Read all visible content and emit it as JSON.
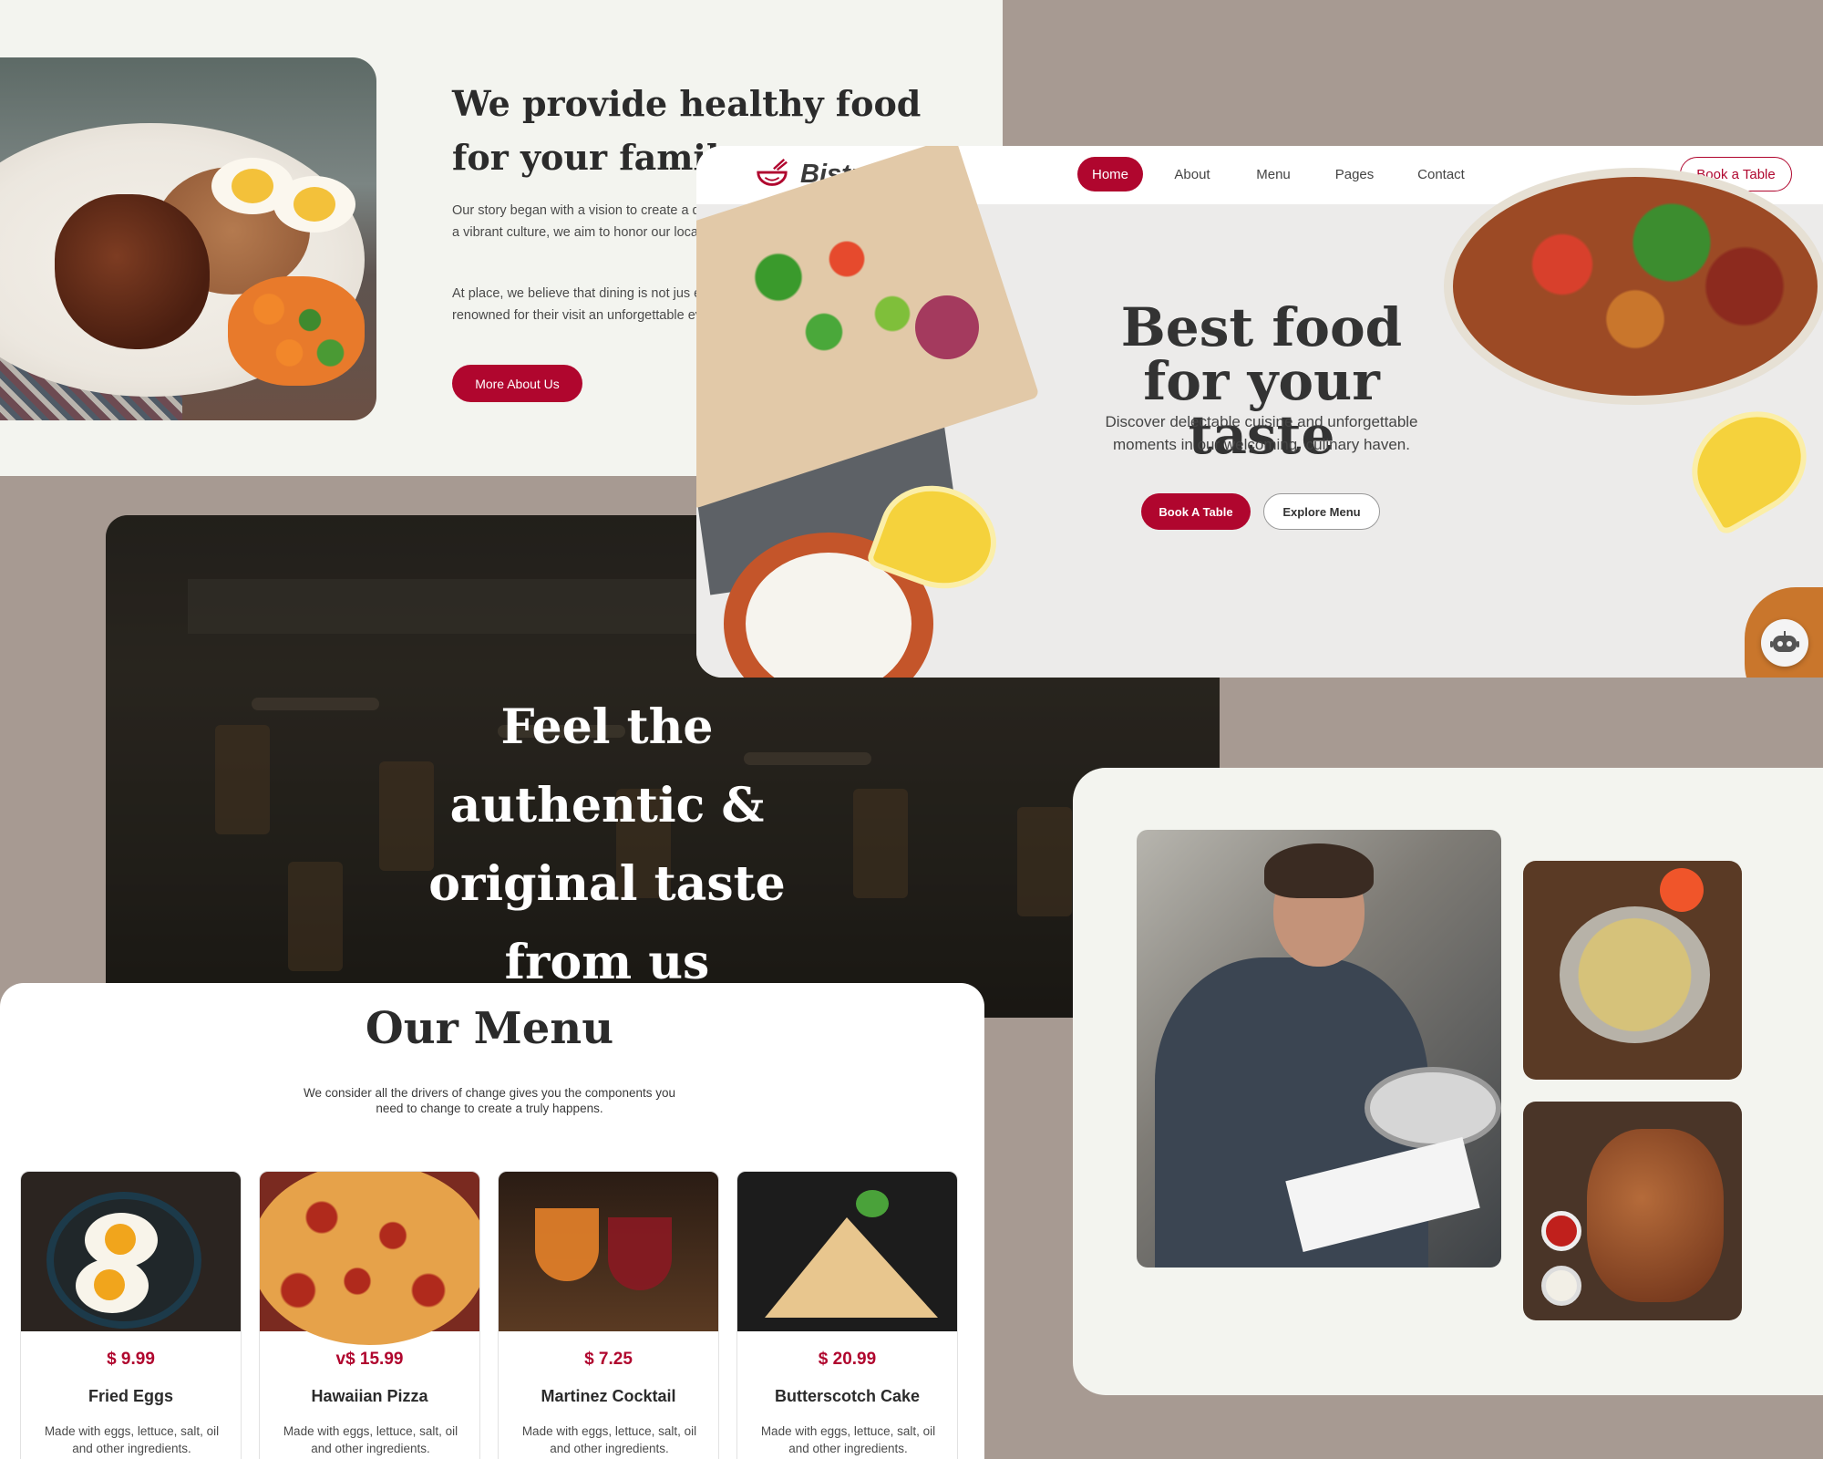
{
  "about": {
    "title": "We provide healthy food for your family.",
    "paragraph1": "Our story began with a vision to create a new unique dining, exceptional service, and a vibrant ambiance. Rooted in city's rich culinary culture, we aim to honor our local roots while infusing a global palate.",
    "paragraph1_visible": "Our story began with a vision to create a dining, exceptional service, and a vibrant culture, we aim to honor our local roots w",
    "paragraph2_visible": "At place, we believe that dining is not jus experience. Our staff, renowned for their visit an unforgettable event.",
    "button_label": "More About Us"
  },
  "banner": {
    "title": "Feel the authentic & original taste from us"
  },
  "hero": {
    "logo_text": "Bistro Bliss",
    "logo_icon": "bowl-icon",
    "nav": [
      {
        "label": "Home",
        "active": true
      },
      {
        "label": "About",
        "active": false
      },
      {
        "label": "Menu",
        "active": false
      },
      {
        "label": "Pages",
        "active": false
      },
      {
        "label": "Contact",
        "active": false
      }
    ],
    "book_table_label": "Book a Table",
    "title": "Best food for your taste",
    "subtitle": "Discover delectable cuisine and unforgettable moments in our welcoming, culinary haven.",
    "primary_button": "Book A Table",
    "secondary_button": "Explore Menu",
    "chatbot_icon": "robot-icon"
  },
  "menu": {
    "title": "Our Menu",
    "subtitle": "We consider all the drivers of change gives you the components you need to change to create a truly happens.",
    "items": [
      {
        "price": "$ 9.99",
        "name": "Fried Eggs",
        "description": "Made with eggs, lettuce, salt, oil and other ingredients."
      },
      {
        "price": "v$ 15.99",
        "name": "Hawaiian Pizza",
        "description": "Made with eggs, lettuce, salt, oil and other ingredients."
      },
      {
        "price": "$ 7.25",
        "name": "Martinez Cocktail",
        "description": "Made with eggs, lettuce, salt, oil and other ingredients."
      },
      {
        "price": "$ 20.99",
        "name": "Butterscotch Cake",
        "description": "Made with eggs, lettuce, salt, oil and other ingredients."
      }
    ]
  },
  "colors": {
    "accent": "#b0062e",
    "background": "#a79a92",
    "panel": "#f3f4ef"
  }
}
